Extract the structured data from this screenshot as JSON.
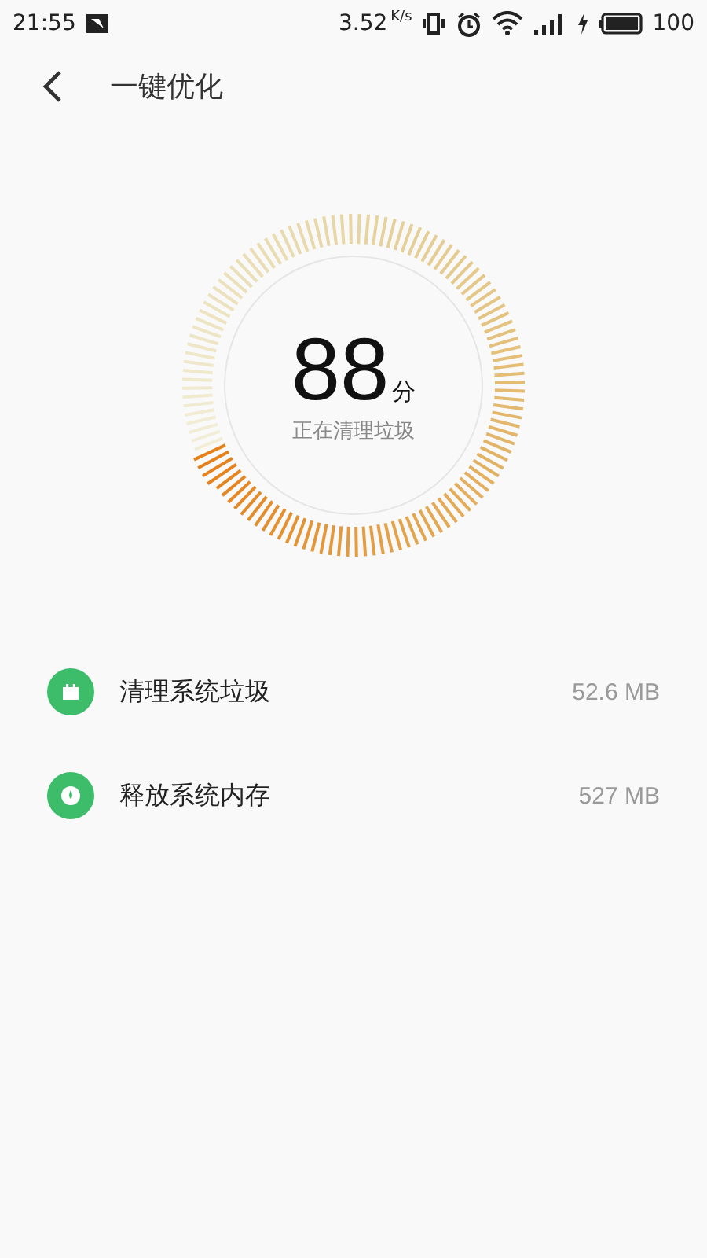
{
  "status_bar": {
    "time": "21:55",
    "speed": "3.52",
    "speed_unit": "K/s",
    "battery": "100"
  },
  "header": {
    "title": "一键优化"
  },
  "score": {
    "value": "88",
    "unit": "分",
    "status": "正在清理垃圾"
  },
  "items": [
    {
      "kind": "trash",
      "label": "清理系统垃圾",
      "size": "52.6 MB"
    },
    {
      "kind": "memory",
      "label": "释放系统内存",
      "size": "527 MB"
    }
  ]
}
